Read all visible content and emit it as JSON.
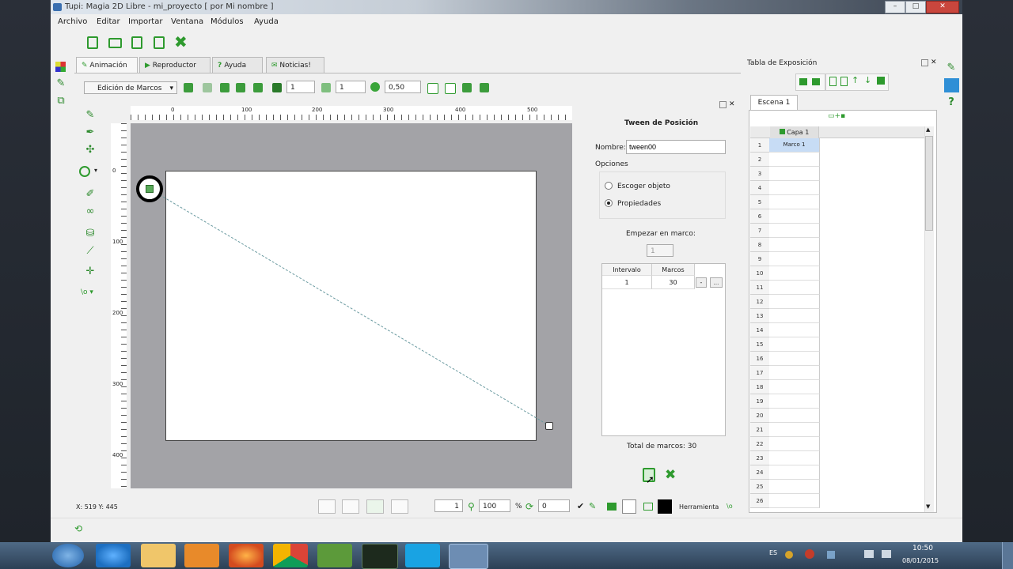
{
  "window": {
    "title": "Tupi: Magia 2D Libre - mi_proyecto [ por Mi nombre ]"
  },
  "menu": [
    "Archivo",
    "Editar",
    "Importar",
    "Ventana",
    "Módulos",
    "Ayuda"
  ],
  "tabs": [
    "Animación",
    "Reproductor",
    "Ayuda",
    "Noticias!"
  ],
  "toolbar": {
    "mode_select": "Edición de Marcos",
    "spin1": "1",
    "spin2": "1",
    "opacity": "0,50"
  },
  "ruler": {
    "top_labels": [
      "0",
      "100",
      "200",
      "300",
      "400",
      "500"
    ],
    "left_labels": [
      "0",
      "100",
      "200",
      "300",
      "400"
    ]
  },
  "tween": {
    "title": "Tween de Posición",
    "name_label": "Nombre:",
    "name_value": "tween00",
    "options_label": "Opciones",
    "option_select": "Escoger objeto",
    "option_props": "Propiedades",
    "start_label": "Empezar en marco:",
    "start_value": "1",
    "table_headers": [
      "Intervalo",
      "Marcos"
    ],
    "table_row": [
      "1",
      "30"
    ],
    "row_btn_minus": "-",
    "row_btn_more": "...",
    "total_label": "Total de marcos: 30"
  },
  "status": {
    "coords": "X: 519 Y: 445",
    "frame": "1",
    "zoom": "100",
    "zoom_unit": "%",
    "rotation": "0",
    "tool_label": "Herramienta"
  },
  "xsheet": {
    "title": "Tabla de Exposición",
    "scene_tab": "Escena 1",
    "layer": "Capa 1",
    "frame1": "Marco 1",
    "rows": [
      "1",
      "2",
      "3",
      "4",
      "5",
      "6",
      "7",
      "8",
      "9",
      "10",
      "11",
      "12",
      "13",
      "14",
      "15",
      "16",
      "17",
      "18",
      "19",
      "20",
      "21",
      "22",
      "23",
      "24",
      "25",
      "26"
    ]
  },
  "taskbar": {
    "lang": "ES",
    "time": "10:50",
    "date": "08/01/2015"
  },
  "colors": {
    "accent_green": "#2e9a2e",
    "canvas_gray": "#a3a3a7",
    "selection_blue": "#c7dcf5"
  }
}
